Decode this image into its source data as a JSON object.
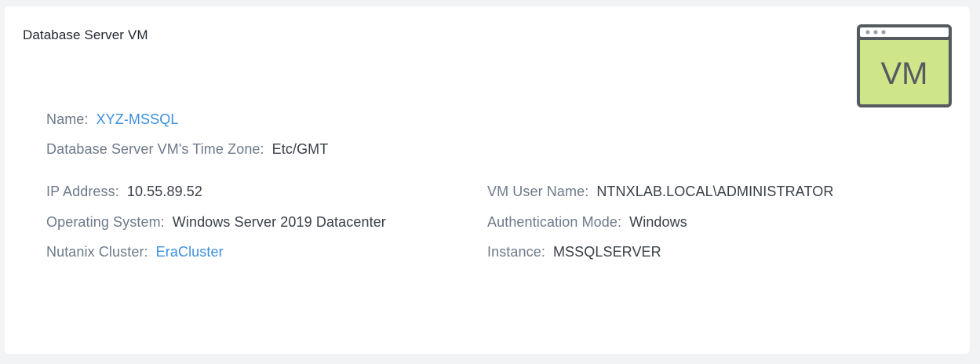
{
  "panel": {
    "title": "Database Server VM",
    "icon": {
      "name": "vm-window-icon",
      "text": "VM",
      "fill": "#cfe58a",
      "stroke": "#555a5f"
    }
  },
  "details": {
    "name": {
      "label": "Name:",
      "value": "XYZ-MSSQL"
    },
    "time_zone": {
      "label": "Database Server VM's Time Zone:",
      "value": "Etc/GMT"
    },
    "ip_address": {
      "label": "IP Address:",
      "value": "10.55.89.52"
    },
    "operating_system": {
      "label": "Operating System:",
      "value": "Windows Server 2019 Datacenter"
    },
    "nutanix_cluster": {
      "label": "Nutanix Cluster:",
      "value": "EraCluster"
    },
    "vm_user_name": {
      "label": "VM User Name:",
      "value": "NTNXLAB.LOCAL\\ADMINISTRATOR"
    },
    "authentication_mode": {
      "label": "Authentication Mode:",
      "value": "Windows"
    },
    "instance": {
      "label": "Instance:",
      "value": "MSSQLSERVER"
    }
  },
  "colors": {
    "link": "#3d8fe0",
    "label": "#6d7a8a",
    "value": "#3a4048",
    "background": "#f2f3f5",
    "card": "#ffffff"
  }
}
